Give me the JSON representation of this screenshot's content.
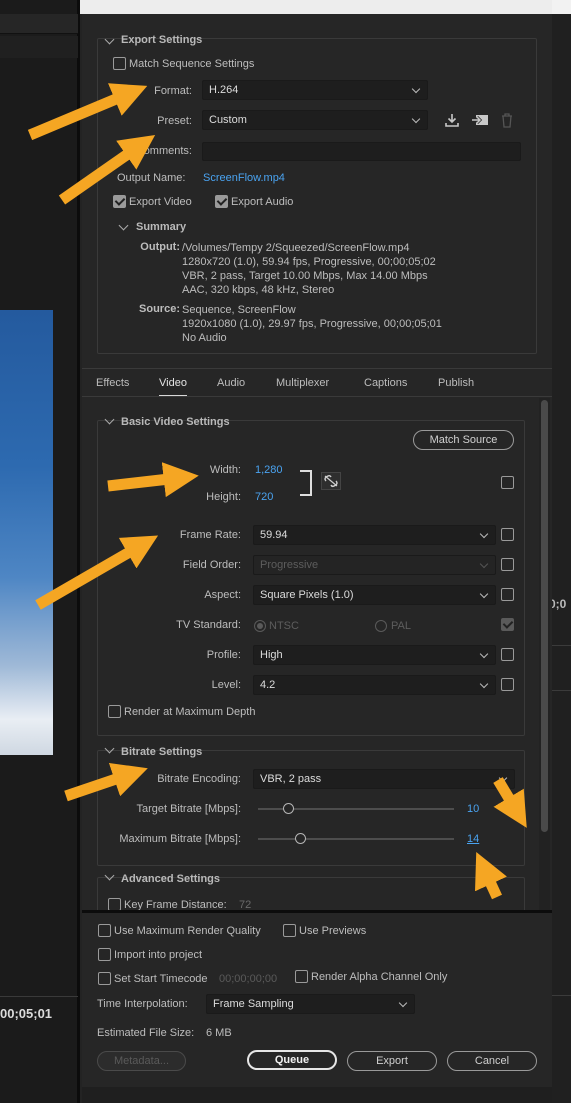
{
  "left_panel": {
    "timecode": "00;05;01"
  },
  "right_strip": {
    "timecode": "0;0"
  },
  "export_settings": {
    "section_title": "Export Settings",
    "match_sequence_label": "Match Sequence Settings",
    "match_sequence_checked": false,
    "format_label": "Format:",
    "format_value": "H.264",
    "preset_label": "Preset:",
    "preset_value": "Custom",
    "comments_label": "Comments:",
    "comments_value": "",
    "output_name_label": "Output Name:",
    "output_name_value": "ScreenFlow.mp4",
    "export_video_label": "Export Video",
    "export_video_checked": true,
    "export_audio_label": "Export Audio",
    "export_audio_checked": true,
    "summary_title": "Summary",
    "output_label": "Output:",
    "output_lines": [
      "/Volumes/Tempy 2/Squeezed/ScreenFlow.mp4",
      "1280x720 (1.0), 59.94 fps, Progressive, 00;00;05;02",
      "VBR, 2 pass, Target 10.00 Mbps, Max 14.00 Mbps",
      "AAC, 320 kbps, 48 kHz, Stereo"
    ],
    "source_label": "Source:",
    "source_lines": [
      "Sequence, ScreenFlow",
      "1920x1080 (1.0), 29.97 fps, Progressive, 00;00;05;01",
      "No Audio"
    ]
  },
  "tabs": [
    {
      "label": "Effects",
      "active": false
    },
    {
      "label": "Video",
      "active": true
    },
    {
      "label": "Audio",
      "active": false
    },
    {
      "label": "Multiplexer",
      "active": false
    },
    {
      "label": "Captions",
      "active": false
    },
    {
      "label": "Publish",
      "active": false
    }
  ],
  "basic_video": {
    "section_title": "Basic Video Settings",
    "match_source_label": "Match Source",
    "width_label": "Width:",
    "width_value": "1,280",
    "height_label": "Height:",
    "height_value": "720",
    "frame_rate_label": "Frame Rate:",
    "frame_rate_value": "59.94",
    "field_order_label": "Field Order:",
    "field_order_value": "Progressive",
    "aspect_label": "Aspect:",
    "aspect_value": "Square Pixels (1.0)",
    "tv_standard_label": "TV Standard:",
    "ntsc_label": "NTSC",
    "pal_label": "PAL",
    "profile_label": "Profile:",
    "profile_value": "High",
    "level_label": "Level:",
    "level_value": "4.2",
    "render_max_depth_label": "Render at Maximum Depth"
  },
  "bitrate": {
    "section_title": "Bitrate Settings",
    "encoding_label": "Bitrate Encoding:",
    "encoding_value": "VBR, 2 pass",
    "target_label": "Target Bitrate [Mbps]:",
    "target_value": "10",
    "target_fraction": 0.16,
    "max_label": "Maximum Bitrate [Mbps]:",
    "max_value": "14",
    "max_fraction": 0.22
  },
  "advanced": {
    "section_title": "Advanced Settings",
    "key_frame_label": "Key Frame Distance:",
    "key_frame_value": "72"
  },
  "bottom": {
    "use_max_render_label": "Use Maximum Render Quality",
    "use_previews_label": "Use Previews",
    "import_project_label": "Import into project",
    "set_start_tc_label": "Set Start Timecode",
    "start_tc_value": "00;00;00;00",
    "render_alpha_label": "Render Alpha Channel Only",
    "time_interp_label": "Time Interpolation:",
    "time_interp_value": "Frame Sampling",
    "est_file_size_label": "Estimated File Size:",
    "est_file_size_value": "6 MB",
    "metadata_label": "Metadata...",
    "queue_label": "Queue",
    "export_label": "Export",
    "cancel_label": "Cancel"
  },
  "colors": {
    "accent_link": "#4aa3f0",
    "annotation_arrow": "#f5a623"
  }
}
